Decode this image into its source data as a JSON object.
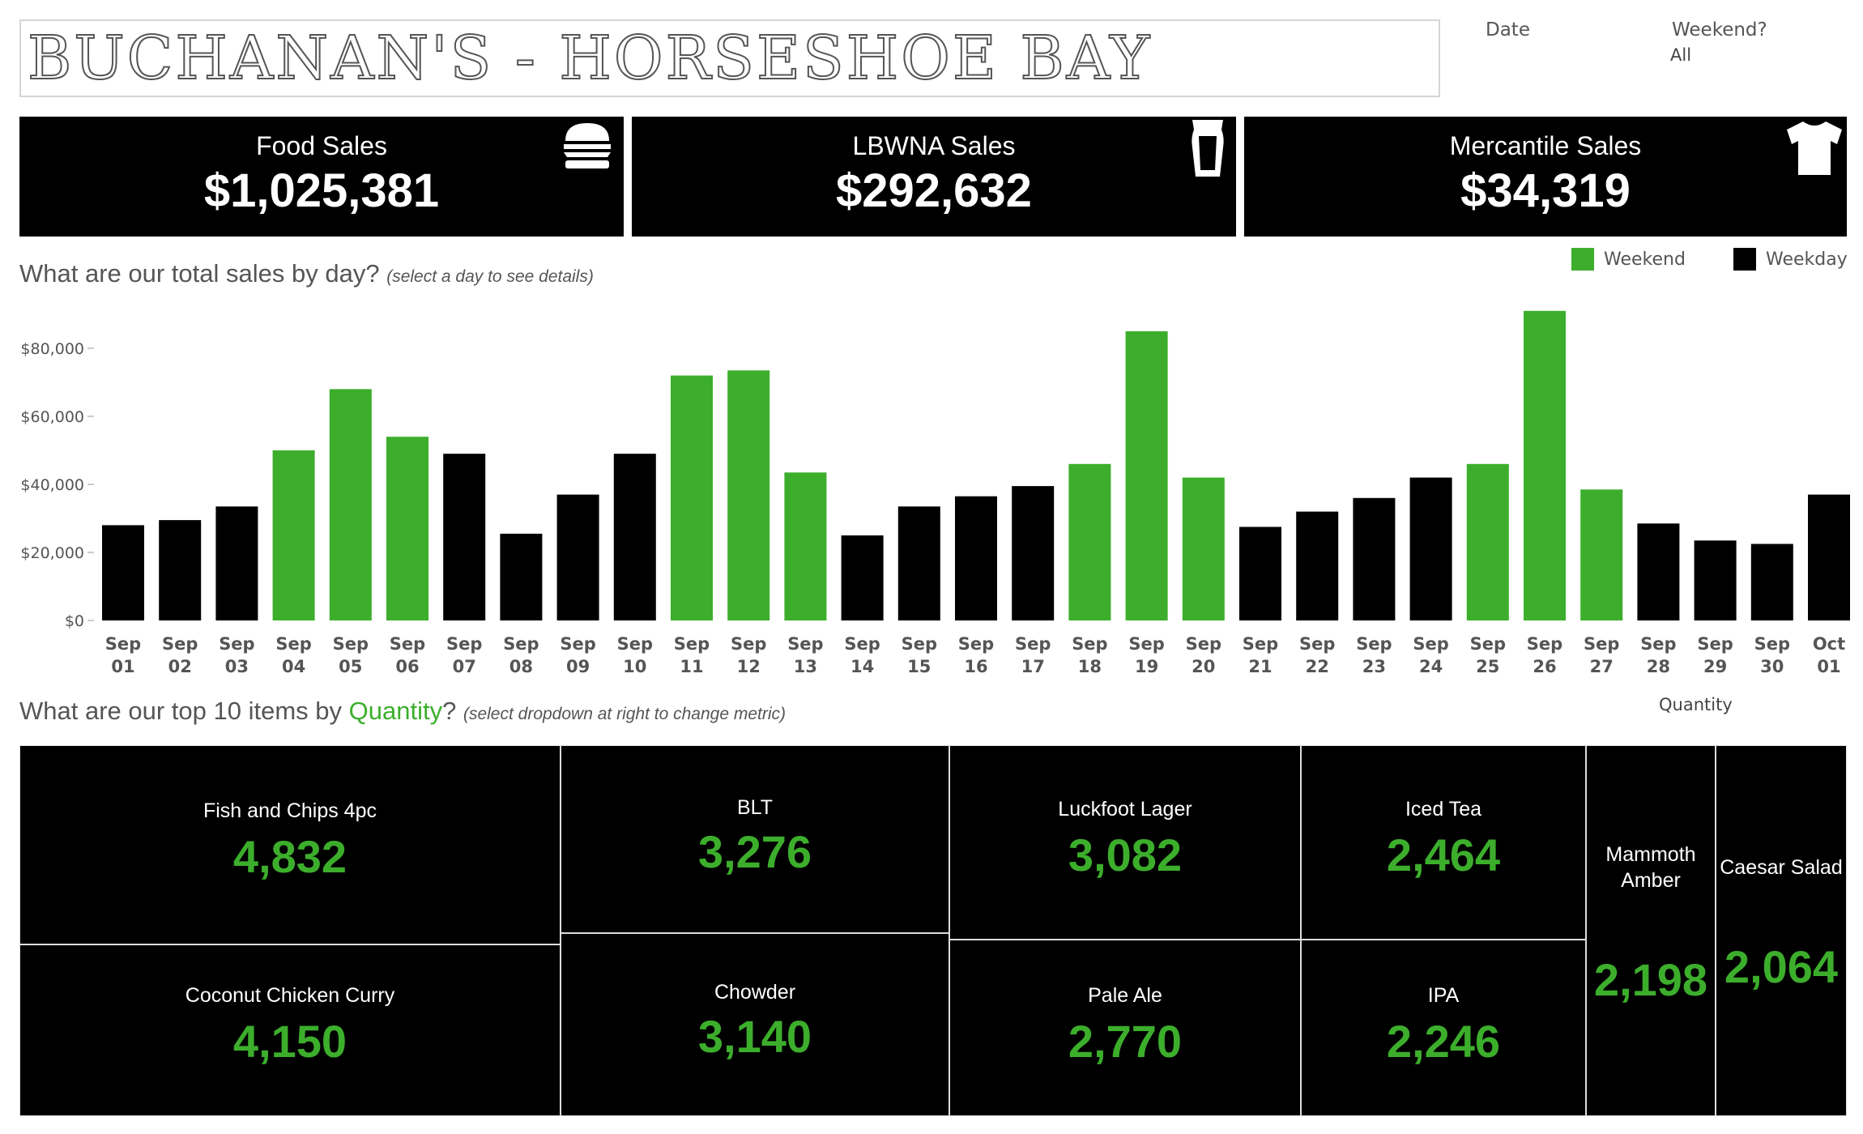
{
  "header": {
    "title": "BUCHANAN'S - HORSESHOE BAY",
    "date_filter_label": "Date",
    "weekend_filter_label": "Weekend?",
    "weekend_filter_value": "All"
  },
  "kpis": [
    {
      "label": "Food Sales",
      "value": "$1,025,381",
      "icon": "burger-icon"
    },
    {
      "label": "LBWNA Sales",
      "value": "$292,632",
      "icon": "beer-glass-icon"
    },
    {
      "label": "Mercantile Sales",
      "value": "$34,319",
      "icon": "tshirt-icon"
    }
  ],
  "sales_section": {
    "title": "What are our total sales by day?",
    "subtitle": "(select a day to see details)"
  },
  "legend": {
    "weekend_label": "Weekend",
    "weekday_label": "Weekday",
    "weekend_color": "#3cae2c",
    "weekday_color": "#000000"
  },
  "chart_data": {
    "type": "bar",
    "categories": [
      "Sep 01",
      "Sep 02",
      "Sep 03",
      "Sep 04",
      "Sep 05",
      "Sep 06",
      "Sep 07",
      "Sep 08",
      "Sep 09",
      "Sep 10",
      "Sep 11",
      "Sep 12",
      "Sep 13",
      "Sep 14",
      "Sep 15",
      "Sep 16",
      "Sep 17",
      "Sep 18",
      "Sep 19",
      "Sep 20",
      "Sep 21",
      "Sep 22",
      "Sep 23",
      "Sep 24",
      "Sep 25",
      "Sep 26",
      "Sep 27",
      "Sep 28",
      "Sep 29",
      "Sep 30",
      "Oct 01"
    ],
    "values": [
      28000,
      29500,
      33500,
      50000,
      68000,
      54000,
      49000,
      25500,
      37000,
      49000,
      72000,
      73500,
      43500,
      25000,
      33500,
      36500,
      39500,
      46000,
      85000,
      42000,
      27500,
      32000,
      36000,
      42000,
      46000,
      91000,
      38500,
      28500,
      23500,
      22500,
      37000
    ],
    "weekend": [
      false,
      false,
      false,
      true,
      true,
      true,
      false,
      false,
      false,
      false,
      true,
      true,
      true,
      false,
      false,
      false,
      false,
      true,
      true,
      true,
      false,
      false,
      false,
      false,
      true,
      true,
      true,
      false,
      false,
      false,
      false
    ],
    "yticks": [
      "$0",
      "$20,000",
      "$40,000",
      "$60,000",
      "$80,000"
    ],
    "ylim": [
      0,
      92000
    ],
    "grid": false
  },
  "top_items_section": {
    "title_prefix": "What are our top 10 items by ",
    "metric": "Quantity",
    "title_suffix": "?",
    "subtitle": "(select dropdown at right to change metric)",
    "dropdown_value": "Quantity"
  },
  "top_items": [
    {
      "name": "Fish and Chips 4pc",
      "value": "4,832"
    },
    {
      "name": "Coconut Chicken Curry",
      "value": "4,150"
    },
    {
      "name": "BLT",
      "value": "3,276"
    },
    {
      "name": "Chowder",
      "value": "3,140"
    },
    {
      "name": "Luckfoot Lager",
      "value": "3,082"
    },
    {
      "name": "Pale Ale",
      "value": "2,770"
    },
    {
      "name": "Iced Tea",
      "value": "2,464"
    },
    {
      "name": "IPA",
      "value": "2,246"
    },
    {
      "name": "Mammoth Amber",
      "value": "2,198"
    },
    {
      "name": "Caesar Salad",
      "value": "2,064"
    }
  ]
}
